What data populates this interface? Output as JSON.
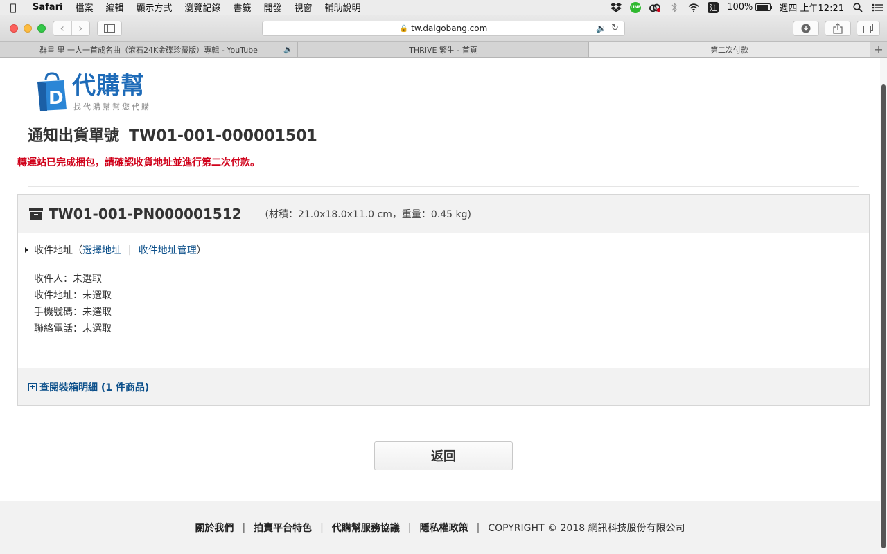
{
  "menubar": {
    "app": "Safari",
    "items": [
      "檔案",
      "編輯",
      "顯示方式",
      "瀏覽記錄",
      "書籤",
      "開發",
      "視窗",
      "輔助說明"
    ],
    "line_label": "LINE",
    "ime": "注",
    "battery": "100%",
    "battery_level": 1.0,
    "clock": "週四 上午12:21"
  },
  "browser": {
    "url": "tw.daigobang.com",
    "tabs": [
      {
        "title": "群星 里 一人一首成名曲（滾石24K金碟珍藏版）專輯 - YouTube",
        "audio": true
      },
      {
        "title": "THRIVE 繁生 - 首頁",
        "audio": false
      },
      {
        "title": "第二次付款",
        "audio": false,
        "active": true
      }
    ],
    "new_tab": "+"
  },
  "logo": {
    "letter": "D",
    "name": "代購幫",
    "slogan": "找代購幫幫您代購"
  },
  "page": {
    "title_label": "通知出貨單號",
    "order_no": "TW01-001-000001501",
    "notice": "轉運站已完成捆包，請確認收貨地址並進行第二次付款。",
    "package": {
      "no": "TW01-001-PN000001512",
      "dims": "(材積：21.0x18.0x11.0 cm，重量：0.45 kg)"
    },
    "address": {
      "label": "收件地址（",
      "select_link": "選擇地址",
      "sep": "|",
      "manage_link": "收件地址管理",
      "close": "）",
      "fields": [
        "收件人：未選取",
        "收件地址：未選取",
        "手機號碼：未選取",
        "聯絡電話：未選取"
      ]
    },
    "detail_link": "查閱裝箱明細 (1 件商品)",
    "back_button": "返回"
  },
  "footer": {
    "links": [
      "關於我們",
      "拍賣平台特色",
      "代購幫服務協議",
      "隱私權政策"
    ],
    "sep": "|",
    "copyright": "COPYRIGHT © 2018 網訊科技股份有限公司"
  },
  "colors": {
    "brand": "#1e6bb8",
    "notice": "#d0021b",
    "link": "#0b4f8a"
  }
}
